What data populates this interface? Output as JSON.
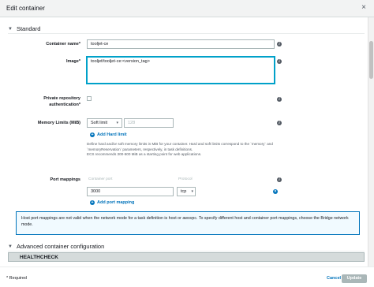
{
  "window": {
    "title": "Edit container",
    "close_glyph": "×"
  },
  "standard": {
    "heading": "Standard",
    "container_name": {
      "label": "Container name*",
      "value": "tooljet-ce"
    },
    "image": {
      "label": "Image*",
      "value": "tooljet/tooljet-ce:<version_tag>"
    },
    "private_repo": {
      "label_line1": "Private repository",
      "label_line2": "authentication*"
    },
    "memory": {
      "label": "Memory Limits (MiB)",
      "type_value": "Soft limit",
      "limit_placeholder": "128",
      "add_link": "Add Hard limit",
      "help_line1": "Define hard and/or soft memory limits in MiB for your container. Hard and soft limits correspond to the `memory` and",
      "help_line2": "`memoryReservation` parameters, respectively, in task definitions.",
      "help_line3": "ECS recommends 300-500 MiB as a starting point for web applications."
    },
    "port_mappings": {
      "label": "Port mappings",
      "col_container_port": "Container port",
      "col_protocol": "Protocol",
      "rows": [
        {
          "container_port": "3000",
          "protocol": "tcp"
        }
      ],
      "add_link": "Add port mapping"
    },
    "info_message": "Host port mappings are not valid when the network mode for a task definition is host or awsvpc. To specify different host and container port mappings, choose the Bridge network mode."
  },
  "advanced": {
    "heading": "Advanced container configuration"
  },
  "healthcheck": {
    "heading": "HEALTHCHECK"
  },
  "footer": {
    "required_note": "* Required",
    "cancel_label": "Cancel",
    "update_label": "Update"
  }
}
